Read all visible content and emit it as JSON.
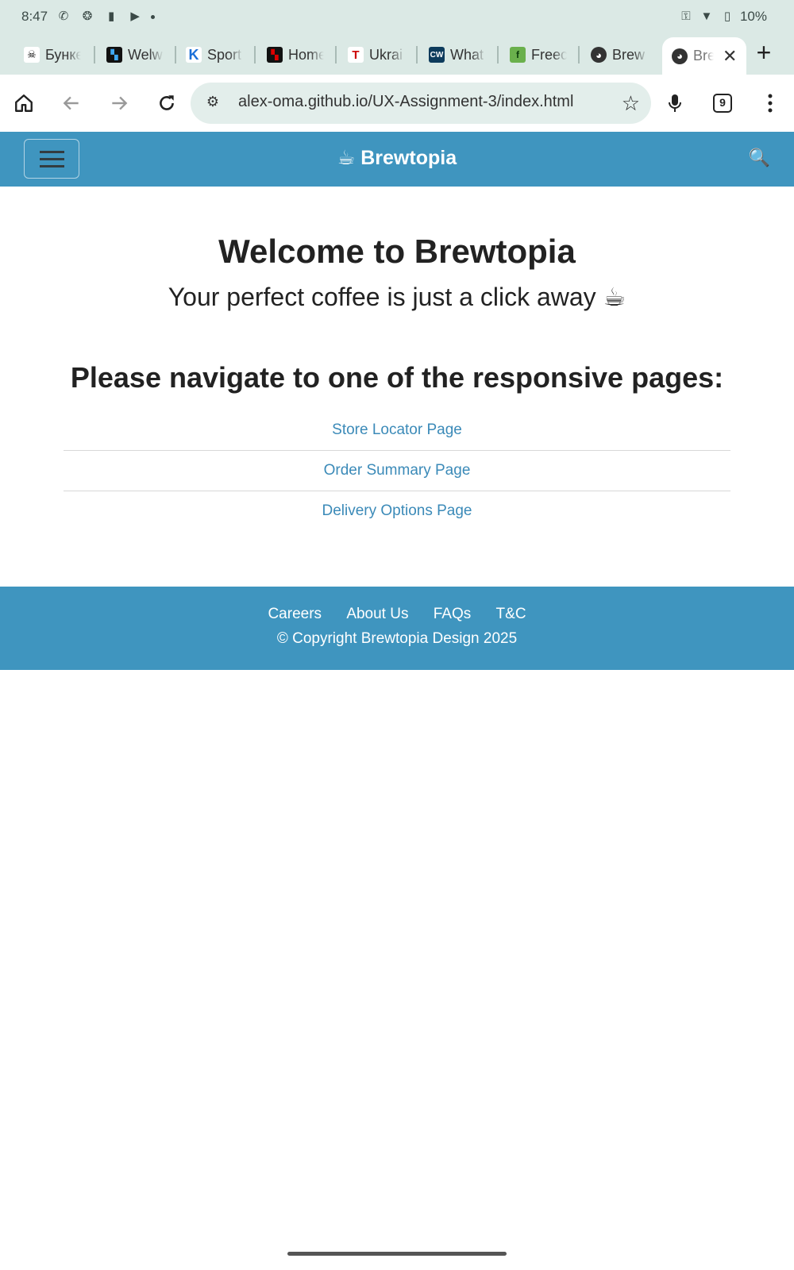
{
  "statusbar": {
    "time": "8:47",
    "battery": "10%"
  },
  "tabs": [
    {
      "label": "Бункер",
      "favicon_color": "#ffffff",
      "favicon_glyph": "☠"
    },
    {
      "label": "Welw",
      "favicon_color": "#111111",
      "favicon_glyph": "▚"
    },
    {
      "label": "Sport",
      "favicon_color": "#ffffff",
      "favicon_glyph": "K"
    },
    {
      "label": "Home",
      "favicon_color": "#cc0000",
      "favicon_glyph": "▚"
    },
    {
      "label": "Ukrai",
      "favicon_color": "#ffffff",
      "favicon_glyph": "T"
    },
    {
      "label": "What",
      "favicon_color": "#0d3b5c",
      "favicon_glyph": "CW"
    },
    {
      "label": "Freec",
      "favicon_color": "#6ab04c",
      "favicon_glyph": "f"
    },
    {
      "label": "Brew",
      "favicon_color": "#333333",
      "favicon_glyph": "🌐"
    },
    {
      "label": "Brewtopia",
      "favicon_color": "#333333",
      "favicon_glyph": "🌐",
      "active": true
    }
  ],
  "toolbar": {
    "url": "alex-oma.github.io/UX-Assignment-3/index.html",
    "tab_count": "9"
  },
  "site": {
    "brand": "☕ Brewtopia",
    "welcome": "Welcome to Brewtopia",
    "tagline": "Your perfect coffee is just a click away ☕",
    "nav_prompt": "Please navigate to one of the responsive pages:",
    "pages": [
      "Store Locator Page",
      "Order Summary Page",
      "Delivery Options Page"
    ],
    "search_icon": "🔍"
  },
  "footer": {
    "links": [
      "Careers",
      "About Us",
      "FAQs",
      "T&C"
    ],
    "copyright": "© Copyright Brewtopia Design 2025"
  },
  "colors": {
    "accent": "#3f95bf",
    "link": "#3b8ab8",
    "chrome": "#dbe9e5"
  }
}
